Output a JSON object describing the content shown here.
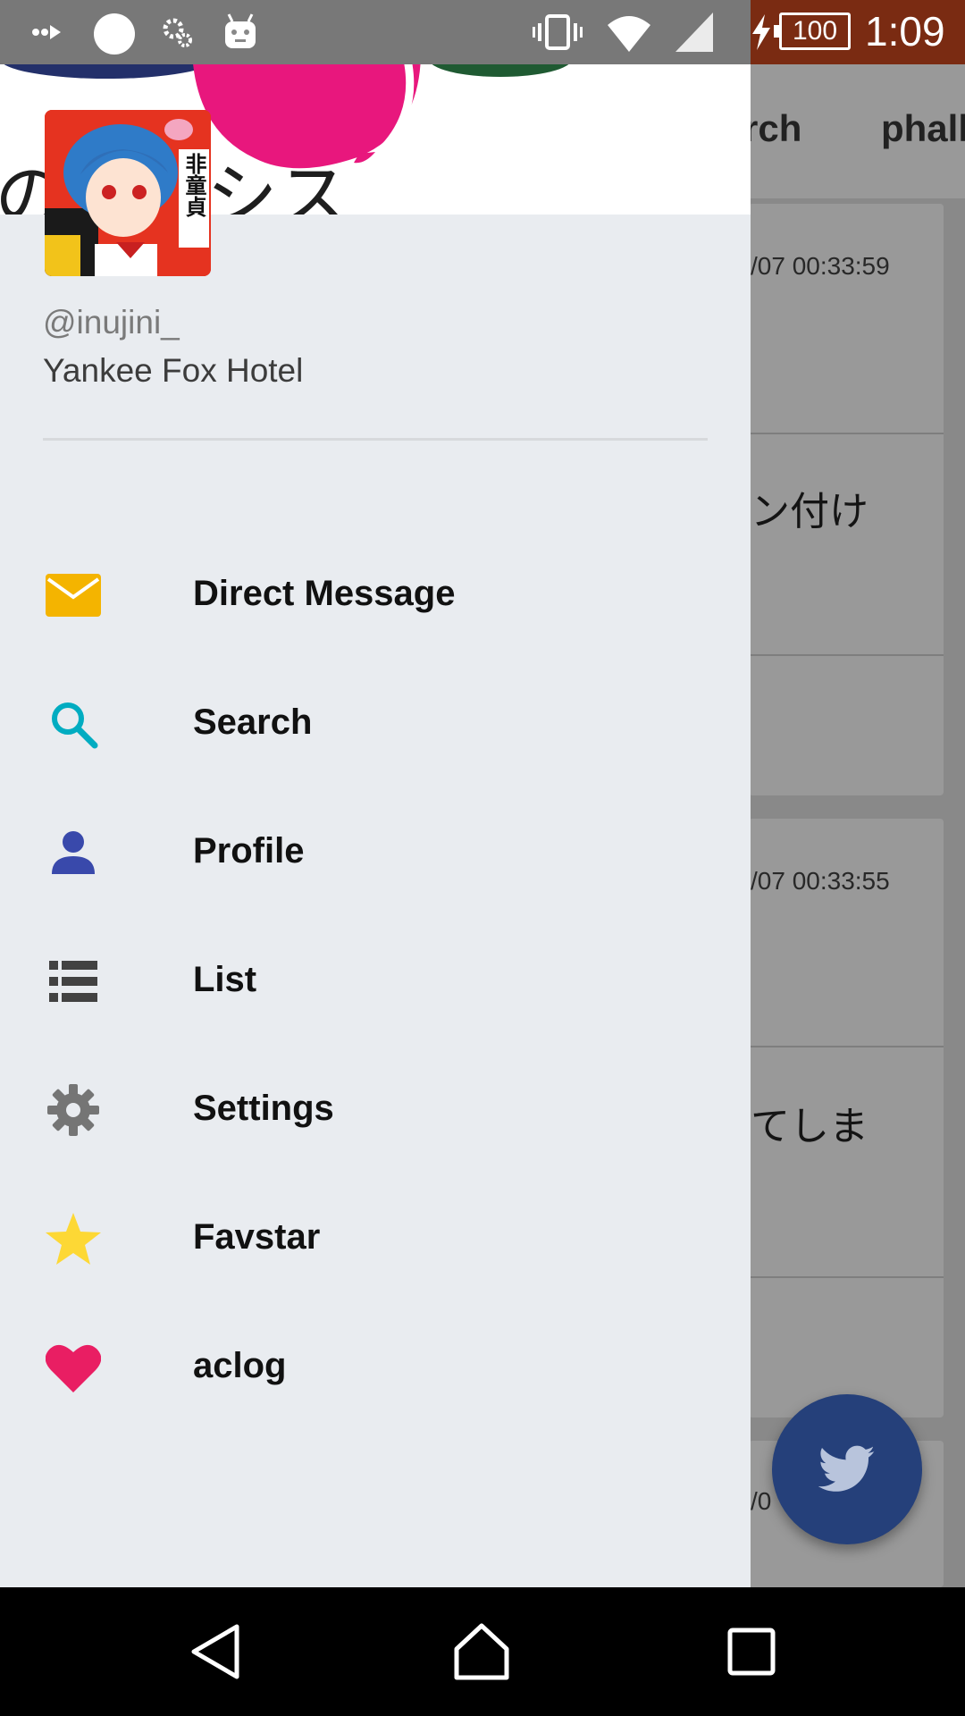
{
  "status_bar": {
    "time": "1:09",
    "battery_level": "100",
    "icons": [
      "overflow-arrows-icon",
      "circle-icon",
      "gears-icon",
      "robot-icon",
      "vibrate-icon",
      "wifi-icon",
      "cell-signal-icon",
      "charging-bolt-icon"
    ]
  },
  "background_app": {
    "tabs": [
      "rch",
      "phall"
    ],
    "timestamps": [
      "/07 00:33:59",
      "/07 00:33:55",
      "/0"
    ],
    "snippets": [
      "ン付け",
      "てしま"
    ],
    "fab_icon": "twitter-bird-icon"
  },
  "drawer": {
    "header_banner_text": "のオアシス",
    "avatar_badge_text": "非童貞",
    "handle": "@inujini_",
    "name": "Yankee Fox Hotel",
    "menu": [
      {
        "label": "Direct Message",
        "icon": "envelope-icon",
        "color": "#F4B400"
      },
      {
        "label": "Search",
        "icon": "search-icon",
        "color": "#00ACC1"
      },
      {
        "label": "Profile",
        "icon": "person-icon",
        "color": "#3949AB"
      },
      {
        "label": "List",
        "icon": "list-icon",
        "color": "#424242"
      },
      {
        "label": "Settings",
        "icon": "gear-icon",
        "color": "#757575"
      },
      {
        "label": "Favstar",
        "icon": "star-icon",
        "color": "#FDD835"
      },
      {
        "label": "aclog",
        "icon": "heart-icon",
        "color": "#E91E63"
      }
    ]
  },
  "nav_bar": {
    "buttons": [
      "back-icon",
      "home-icon",
      "recents-icon"
    ]
  }
}
